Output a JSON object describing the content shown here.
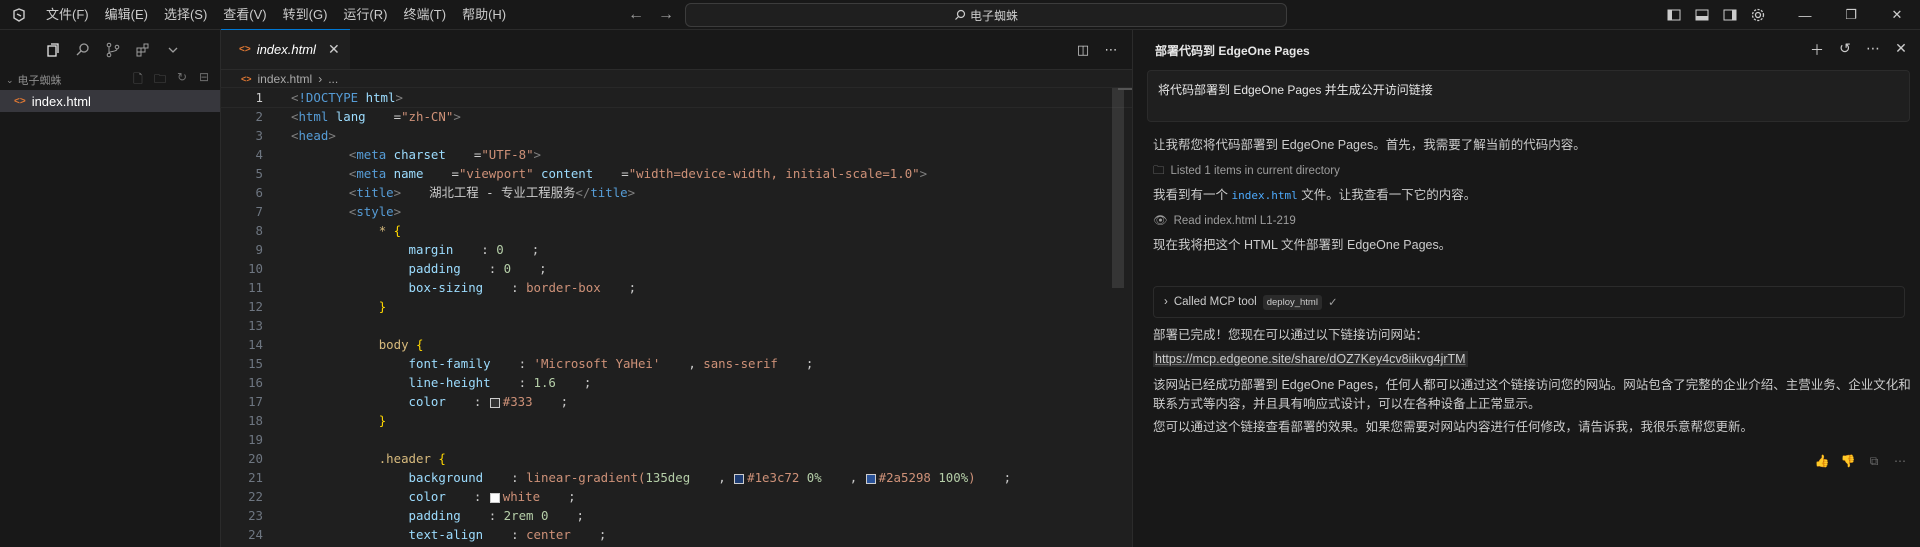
{
  "menu": [
    "文件(F)",
    "编辑(E)",
    "选择(S)",
    "查看(V)",
    "转到(G)",
    "运行(R)",
    "终端(T)",
    "帮助(H)"
  ],
  "search": {
    "text": "电子蜘蛛"
  },
  "explorer": {
    "folder": "电子蜘蛛",
    "files": [
      "index.html"
    ]
  },
  "editor": {
    "tab": "index.html",
    "breadcrumb_file": "index.html",
    "breadcrumb_more": "...",
    "current_line": 1
  },
  "code_lines": [
    [
      {
        "c": "punc",
        "t": "<"
      },
      {
        "c": "tag",
        "t": "!DOCTYPE"
      },
      {
        "c": "attr",
        "t": " html"
      },
      {
        "c": "punc",
        "t": ">"
      }
    ],
    [
      {
        "c": "punc",
        "t": "<"
      },
      {
        "c": "tag",
        "t": "html"
      },
      {
        "c": "attr",
        "t": " lang"
      },
      {
        "c": "txt",
        "t": "="
      },
      {
        "c": "str",
        "t": "\"zh-CN\""
      },
      {
        "c": "punc",
        "t": ">"
      }
    ],
    [
      {
        "c": "punc",
        "t": "<"
      },
      {
        "c": "tag",
        "t": "head"
      },
      {
        "c": "punc",
        "t": ">"
      }
    ],
    [
      {
        "c": "txt",
        "t": "    "
      },
      {
        "c": "punc",
        "t": "<"
      },
      {
        "c": "tag",
        "t": "meta"
      },
      {
        "c": "attr",
        "t": " charset"
      },
      {
        "c": "txt",
        "t": "="
      },
      {
        "c": "str",
        "t": "\"UTF-8\""
      },
      {
        "c": "punc",
        "t": ">"
      }
    ],
    [
      {
        "c": "txt",
        "t": "    "
      },
      {
        "c": "punc",
        "t": "<"
      },
      {
        "c": "tag",
        "t": "meta"
      },
      {
        "c": "attr",
        "t": " name"
      },
      {
        "c": "txt",
        "t": "="
      },
      {
        "c": "str",
        "t": "\"viewport\""
      },
      {
        "c": "attr",
        "t": " content"
      },
      {
        "c": "txt",
        "t": "="
      },
      {
        "c": "str",
        "t": "\"width=device-width, initial-scale=1.0\""
      },
      {
        "c": "punc",
        "t": ">"
      }
    ],
    [
      {
        "c": "txt",
        "t": "    "
      },
      {
        "c": "punc",
        "t": "<"
      },
      {
        "c": "tag",
        "t": "title"
      },
      {
        "c": "punc",
        "t": ">"
      },
      {
        "c": "txt",
        "t": "湖北工程 - 专业工程服务"
      },
      {
        "c": "punc",
        "t": "</"
      },
      {
        "c": "tag",
        "t": "title"
      },
      {
        "c": "punc",
        "t": ">"
      }
    ],
    [
      {
        "c": "txt",
        "t": "    "
      },
      {
        "c": "punc",
        "t": "<"
      },
      {
        "c": "tag",
        "t": "style"
      },
      {
        "c": "punc",
        "t": ">"
      }
    ],
    [
      {
        "c": "txt",
        "t": "        "
      },
      {
        "c": "sel",
        "t": "*"
      },
      {
        "c": "brace",
        "t": " {"
      }
    ],
    [
      {
        "c": "txt",
        "t": "            "
      },
      {
        "c": "prop",
        "t": "margin"
      },
      {
        "c": "txt",
        "t": ": "
      },
      {
        "c": "num",
        "t": "0"
      },
      {
        "c": "txt",
        "t": ";"
      }
    ],
    [
      {
        "c": "txt",
        "t": "            "
      },
      {
        "c": "prop",
        "t": "padding"
      },
      {
        "c": "txt",
        "t": ": "
      },
      {
        "c": "num",
        "t": "0"
      },
      {
        "c": "txt",
        "t": ";"
      }
    ],
    [
      {
        "c": "txt",
        "t": "            "
      },
      {
        "c": "prop",
        "t": "box-sizing"
      },
      {
        "c": "txt",
        "t": ": "
      },
      {
        "c": "val",
        "t": "border-box"
      },
      {
        "c": "txt",
        "t": ";"
      }
    ],
    [
      {
        "c": "txt",
        "t": "        "
      },
      {
        "c": "brace",
        "t": "}"
      }
    ],
    [],
    [
      {
        "c": "txt",
        "t": "        "
      },
      {
        "c": "sel",
        "t": "body"
      },
      {
        "c": "brace",
        "t": " {"
      }
    ],
    [
      {
        "c": "txt",
        "t": "            "
      },
      {
        "c": "prop",
        "t": "font-family"
      },
      {
        "c": "txt",
        "t": ": "
      },
      {
        "c": "val",
        "t": "'Microsoft YaHei'"
      },
      {
        "c": "txt",
        "t": ", "
      },
      {
        "c": "val",
        "t": "sans-serif"
      },
      {
        "c": "txt",
        "t": ";"
      }
    ],
    [
      {
        "c": "txt",
        "t": "            "
      },
      {
        "c": "prop",
        "t": "line-height"
      },
      {
        "c": "txt",
        "t": ": "
      },
      {
        "c": "num",
        "t": "1.6"
      },
      {
        "c": "txt",
        "t": ";"
      }
    ],
    [
      {
        "c": "txt",
        "t": "            "
      },
      {
        "c": "prop",
        "t": "color"
      },
      {
        "c": "txt",
        "t": ": "
      },
      {
        "c": "swatch",
        "t": "#333333"
      },
      {
        "c": "val",
        "t": "#333"
      },
      {
        "c": "txt",
        "t": ";"
      }
    ],
    [
      {
        "c": "txt",
        "t": "        "
      },
      {
        "c": "brace",
        "t": "}"
      }
    ],
    [],
    [
      {
        "c": "txt",
        "t": "        "
      },
      {
        "c": "sel",
        "t": ".header"
      },
      {
        "c": "brace",
        "t": " {"
      }
    ],
    [
      {
        "c": "txt",
        "t": "            "
      },
      {
        "c": "prop",
        "t": "background"
      },
      {
        "c": "txt",
        "t": ": "
      },
      {
        "c": "val",
        "t": "linear-gradient("
      },
      {
        "c": "num",
        "t": "135deg"
      },
      {
        "c": "txt",
        "t": ", "
      },
      {
        "c": "swatch",
        "t": "#1e3c72"
      },
      {
        "c": "val",
        "t": "#1e3c72"
      },
      {
        "c": "num",
        "t": " 0%"
      },
      {
        "c": "txt",
        "t": ", "
      },
      {
        "c": "swatch",
        "t": "#2a5298"
      },
      {
        "c": "val",
        "t": "#2a5298"
      },
      {
        "c": "num",
        "t": " 100%"
      },
      {
        "c": "val",
        "t": ")"
      },
      {
        "c": "txt",
        "t": ";"
      }
    ],
    [
      {
        "c": "txt",
        "t": "            "
      },
      {
        "c": "prop",
        "t": "color"
      },
      {
        "c": "txt",
        "t": ": "
      },
      {
        "c": "swatch",
        "t": "#ffffff"
      },
      {
        "c": "val",
        "t": "white"
      },
      {
        "c": "txt",
        "t": ";"
      }
    ],
    [
      {
        "c": "txt",
        "t": "            "
      },
      {
        "c": "prop",
        "t": "padding"
      },
      {
        "c": "txt",
        "t": ": "
      },
      {
        "c": "num",
        "t": "2rem"
      },
      {
        "c": "num",
        "t": " 0"
      },
      {
        "c": "txt",
        "t": ";"
      }
    ],
    [
      {
        "c": "txt",
        "t": "            "
      },
      {
        "c": "prop",
        "t": "text-align"
      },
      {
        "c": "txt",
        "t": ": "
      },
      {
        "c": "val",
        "t": "center"
      },
      {
        "c": "txt",
        "t": ";"
      }
    ]
  ],
  "chat": {
    "title": "部署代码到 EdgeOne Pages",
    "request": "将代码部署到 EdgeOne Pages 并生成公开访问链接",
    "m1": "让我帮您将代码部署到 EdgeOne Pages。首先，我需要了解当前的代码内容。",
    "m2": "Listed 1 items in current directory",
    "m3a": "我看到有一个",
    "m3code": "index.html",
    "m3b": "文件。让我查看一下它的内容。",
    "m4": "Read index.html L1-219",
    "m5": "现在我将把这个 HTML 文件部署到 EdgeOne Pages。",
    "tool_label": "Called MCP tool",
    "tool_chip": "deploy_html",
    "m6": "部署已完成！您现在可以通过以下链接访问网站：",
    "link": "https://mcp.edgeone.site/share/dOZ7Key4cv8iikvg4jrTM",
    "m7": "该网站已经成功部署到 EdgeOne Pages，任何人都可以通过这个链接访问您的网站。网站包含了完整的企业介绍、主营业务、企业文化和联系方式等内容，并且具有响应式设计，可以在各种设备上正常显示。",
    "m8": "您可以通过这个链接查看部署的效果。如果您需要对网站内容进行任何修改，请告诉我，我很乐意帮您更新。"
  }
}
